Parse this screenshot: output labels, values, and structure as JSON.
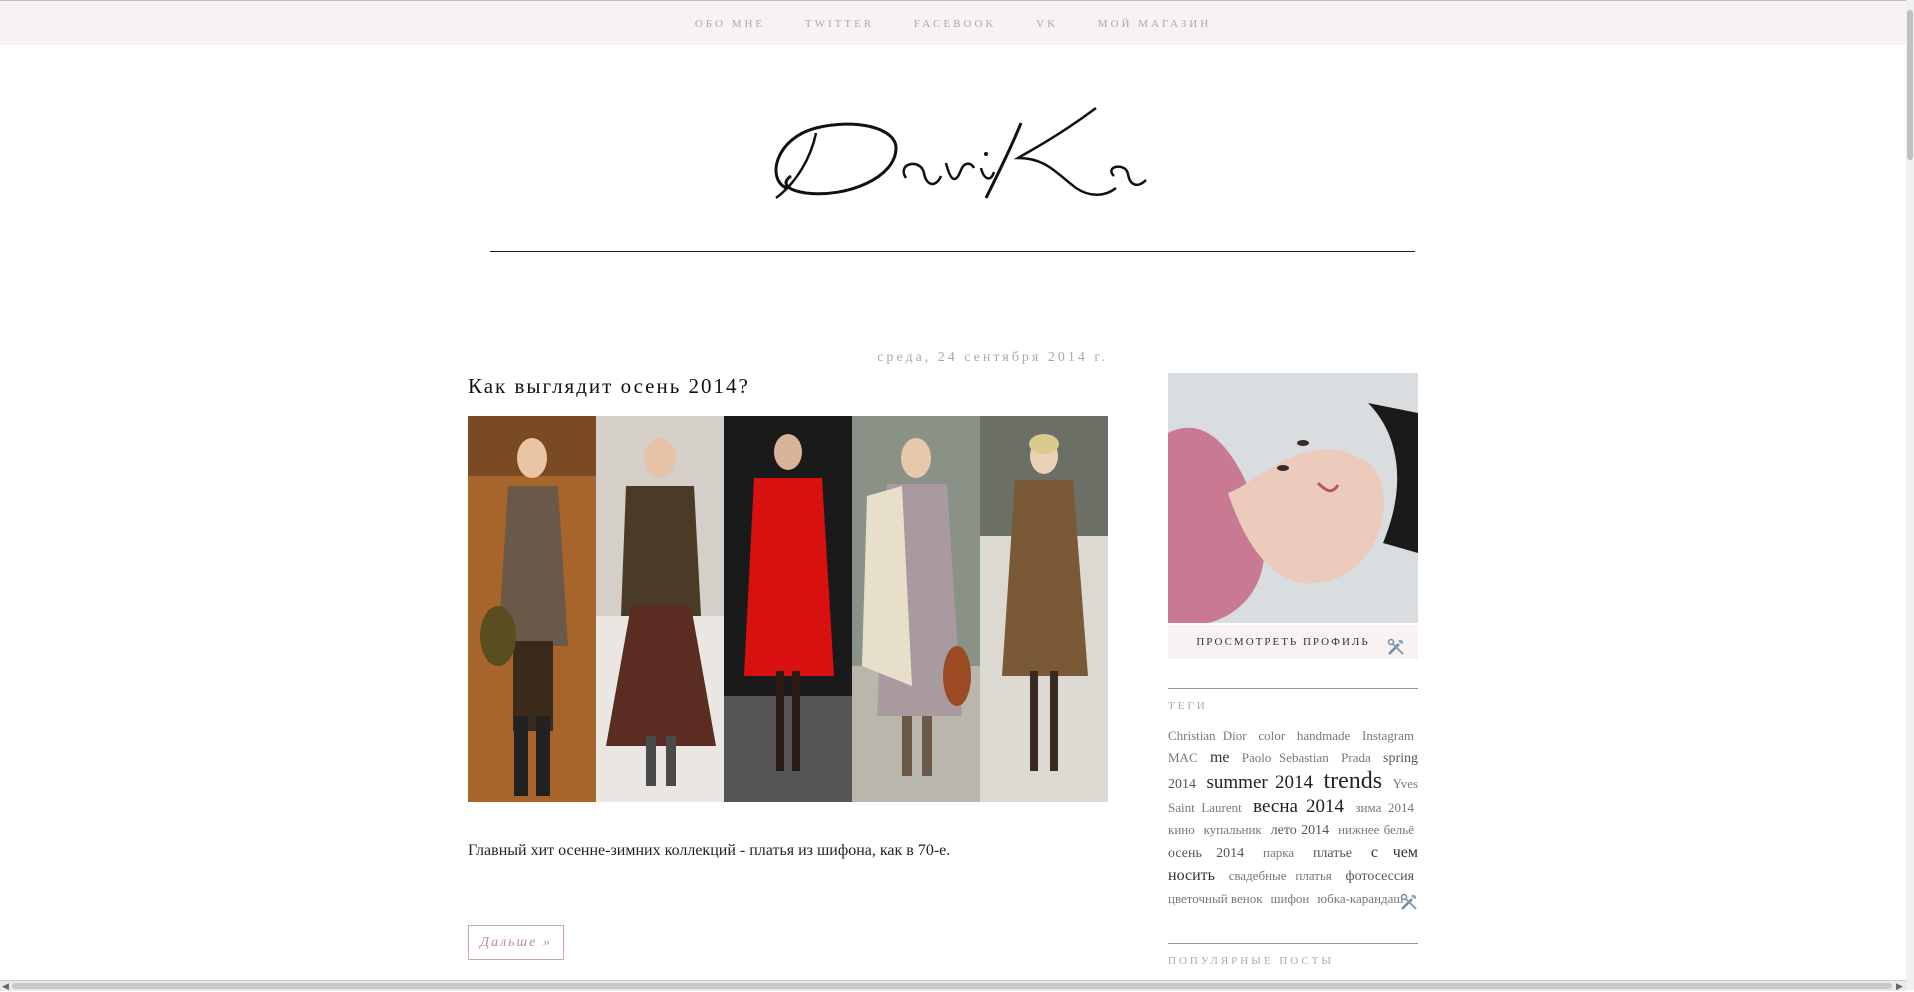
{
  "nav": {
    "items": [
      "ОБО МНЕ",
      "TWITTER",
      "FACEBOOK",
      "VK",
      "МОЙ МАГАЗИН"
    ]
  },
  "blog": {
    "logo": "DariKa"
  },
  "post": {
    "date": "среда, 24 сентября 2014 г.",
    "title": "Как выглядит осень 2014?",
    "text": "Главный хит осенне-зимних коллекций - платья из шифона, как в 70-е.",
    "more_label": "Дальше »"
  },
  "sidebar": {
    "profile_link": "ПРОСМОТРЕТЬ ПРОФИЛЬ",
    "tags_title": "ТЕГИ",
    "popular_title": "ПОПУЛЯРНЫЕ ПОСТЫ",
    "tags": [
      {
        "label": "Christian Dior",
        "size": 1
      },
      {
        "label": "color",
        "size": 1
      },
      {
        "label": "handmade",
        "size": 1
      },
      {
        "label": "Instagram",
        "size": 1
      },
      {
        "label": "MAC",
        "size": 1
      },
      {
        "label": "me",
        "size": 3
      },
      {
        "label": "Paolo Sebastian",
        "size": 1
      },
      {
        "label": "Prada",
        "size": 1
      },
      {
        "label": "spring 2014",
        "size": 2
      },
      {
        "label": "summer 2014",
        "size": 4
      },
      {
        "label": "trends",
        "size": 5
      },
      {
        "label": "Yves Saint Laurent",
        "size": 1
      },
      {
        "label": "весна 2014",
        "size": 4
      },
      {
        "label": "зима 2014",
        "size": 1
      },
      {
        "label": "кино",
        "size": 1
      },
      {
        "label": "купальник",
        "size": 1
      },
      {
        "label": "лето 2014",
        "size": 2
      },
      {
        "label": "нижнее бельё",
        "size": 1
      },
      {
        "label": "осень 2014",
        "size": 2
      },
      {
        "label": "парка",
        "size": 1
      },
      {
        "label": "платье",
        "size": 2
      },
      {
        "label": "с чем носить",
        "size": 3
      },
      {
        "label": "свадебные платья",
        "size": 1
      },
      {
        "label": "фотосессия",
        "size": 2
      },
      {
        "label": "цветочный венок",
        "size": 1
      },
      {
        "label": "шифон",
        "size": 1
      },
      {
        "label": "юбка-карандаш",
        "size": 1
      }
    ]
  },
  "colors": {
    "topbar_bg": "#f8f3f2",
    "accent_pink": "#c9a5b0",
    "muted_text": "#aaaaaa"
  },
  "icons": {
    "edit": "tools-icon"
  }
}
